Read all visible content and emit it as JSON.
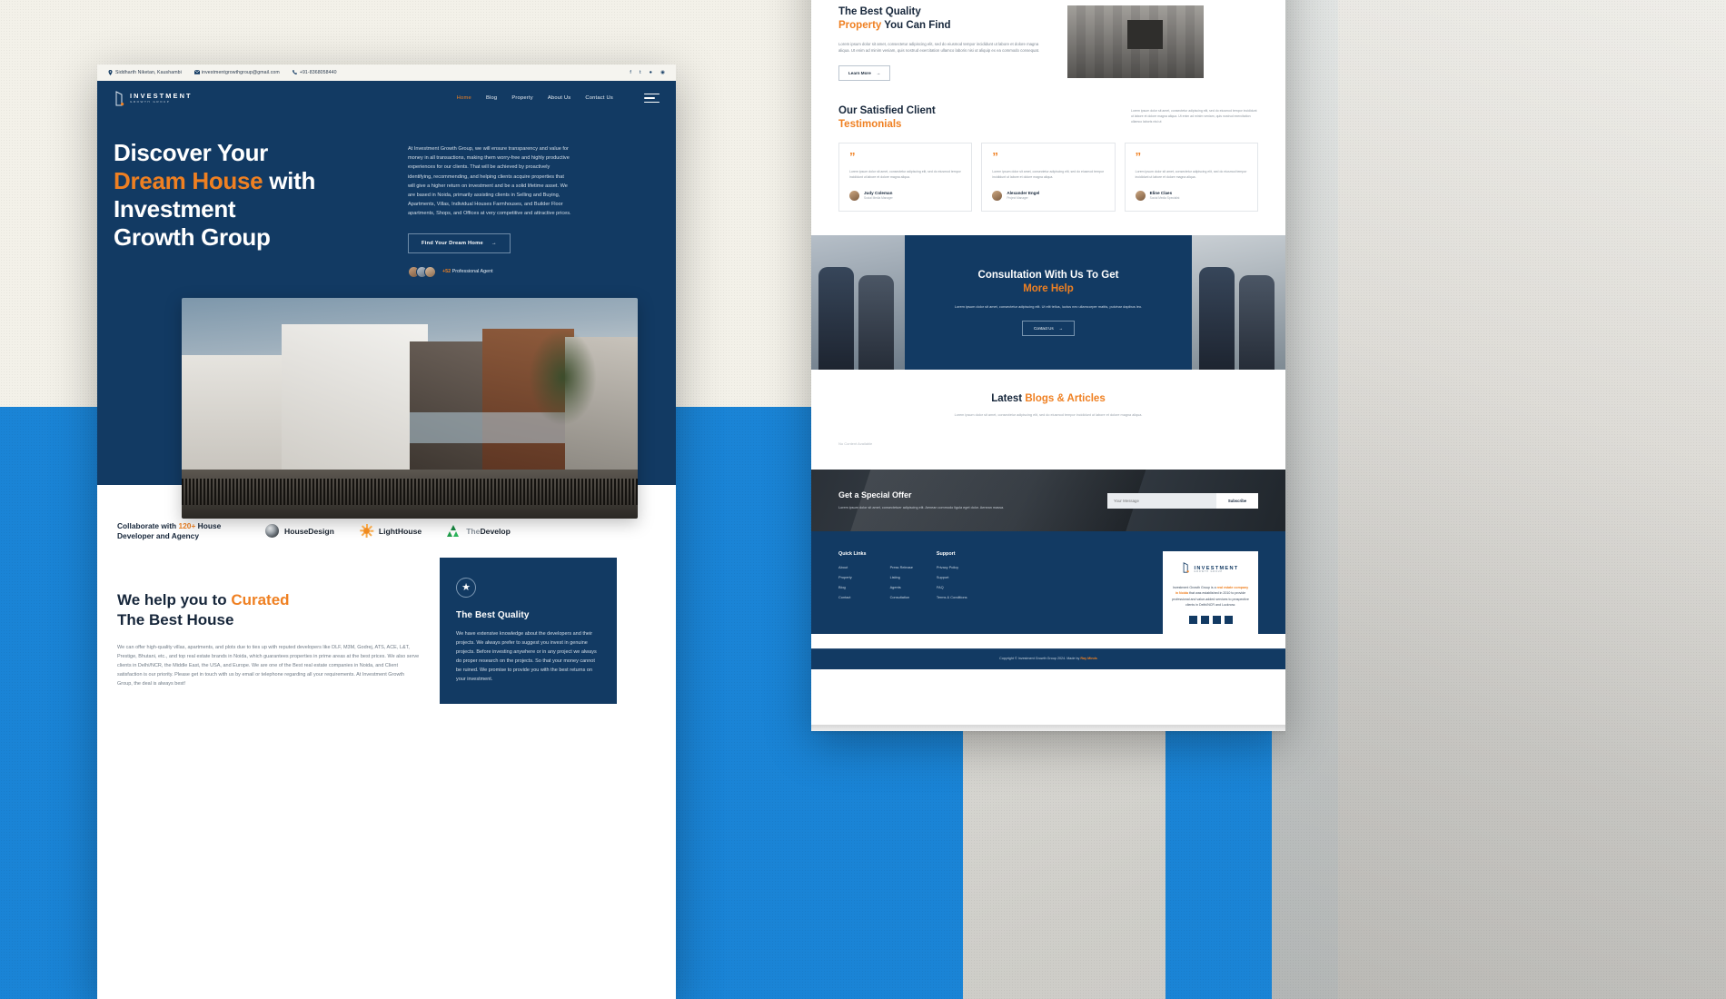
{
  "topbar": {
    "address": "Siddharth Niketan, Kaushambi",
    "email": "investmentgrowthgroup@gmail.com",
    "phone": "+91-8368058440",
    "socials": [
      "facebook",
      "twitter",
      "github",
      "dribbble"
    ]
  },
  "brand": {
    "name": "INVESTMENT",
    "tagline": "GROWTH GROUP"
  },
  "nav": {
    "items": [
      "Home",
      "Blog",
      "Property",
      "About Us",
      "Contact Us"
    ],
    "active": "Home"
  },
  "hero": {
    "title_line1": "Discover Your",
    "title_accent": "Dream House",
    "title_after": " with",
    "title_line3": "Investment",
    "title_line4": "Growth Group",
    "paragraph": "At Investment Growth Group, we will ensure transparency and value for money in all transactions, making them worry-free and highly productive experiences for our clients. That will be achieved by proactively identifying, recommending, and helping clients acquire properties that will give a higher return on investment and be a solid lifetime asset. We are based in Noida, primarily assisting clients in Selling and Buying, Apartments, Villas, Individual Houses Farmhouses, and Builder Floor apartments, Shops, and Offices at very competitive and attractive prices.",
    "cta": "Find Your Dream Home",
    "agent_count": "+52",
    "agent_label": "Professional Agent"
  },
  "partners": {
    "text_pre": "Collaborate with ",
    "text_accent": "120+",
    "text_post": " House Developer and Agency",
    "logos": [
      {
        "name": "HouseDesign",
        "icon": "sphere-icon"
      },
      {
        "name": "LightHouse",
        "icon": "sun-icon"
      },
      {
        "name": "TheDevelop",
        "icon": "triangles-icon",
        "grey_part": "The"
      }
    ]
  },
  "curated": {
    "title_pre": "We help you to ",
    "title_accent": "Curated",
    "title_line2": "The Best House",
    "paragraph": "We can offer high-quality villas, apartments, and plots due to ties up with reputed developers like DLF, M3M, Godrej, ATS, ACE, L&T, Prestige, Bhutani, etc., and top real estate brands in Noida, which guarantees properties in prime areas at the best prices. We also serve clients in Delhi/NCR, the Middle East, the USA, and Europe. We are one of the Best real estate companies in Noida, and Client satisfaction is our priority. Please get in touch with us by email or telephone regarding all your requirements. At Investment Growth Group, the deal is always best!",
    "card": {
      "icon": "award-icon",
      "title": "The Best Quality",
      "paragraph": "We have extensive knowledge about the developers and their projects. We always prefer to suggest you invest in genuine projects. Before investing anywhere or in any project we always do proper research on the projects. So that your money cannot be ruined. We promise to provide you with the best returns on your investment."
    }
  },
  "quality": {
    "title_line1": "The Best Quality",
    "title_accent": "Property",
    "title_after": " You Can Find",
    "paragraph": "Lorem ipsum dolor sit amet, consectetur adipiscing elit, sed do eiusmod tempor incididunt ut labore et dolore magna aliqua. Ut enim ad minim veniam, quis nostrud exercitation ullamco laboris nisi ut aliquip ex ea commodo consequat.",
    "cta": "Learn More"
  },
  "testimonials": {
    "title_line1": "Our Satisfied Client",
    "title_accent": "Testimonials",
    "side_paragraph": "Lorem ipsum dolor sit amet, consectetur adipiscing elit, sed do eiusmod tempor incididunt ut labore et dolore magna aliqua. Ut enim ad minim veniam, quis nostrud exercitation ullamco laboris nisi ut",
    "items": [
      {
        "quote": "Lorem ipsum dolor sit amet, consectetur adipiscing elit, sed do eiusmod tempor incididunt ut labore et dolore magna aliqua.",
        "name": "Judy Coleman",
        "role": "Social Media Manager"
      },
      {
        "quote": "Lorem ipsum dolor sit amet, consectetur adipiscing elit, sed do eiusmod tempor incididunt ut labore et dolore magna aliqua.",
        "name": "Alexander Engel",
        "role": "Project Manager"
      },
      {
        "quote": "Lorem ipsum dolor sit amet, consectetur adipiscing elit, sed do eiusmod tempor incididunt ut labore et dolore magna aliqua.",
        "name": "Eline Claes",
        "role": "Social Media Specialist"
      }
    ]
  },
  "consultation": {
    "title_line1": "Consultation With Us To Get",
    "title_accent": "More Help",
    "paragraph": "Lorem ipsum dolor sit amet, consectetur adipiscing elit. Ut elit tellus, luctus nec ullamcorper mattis, pulvinar dapibus leo.",
    "cta": "Contact Us"
  },
  "blogs": {
    "title_pre": "Latest ",
    "title_accent": "Blogs & Articles",
    "paragraph": "Lorem ipsum dolor sit amet, consectetur adipiscing elit, sed do eiusmod tempor incididunt ut labore et dolore magna aliqua.",
    "empty": "No Content Available"
  },
  "offer": {
    "title": "Get a Special Offer",
    "paragraph": "Lorem ipsum dolor sit amet, consectetuer adipiscing elit. Aenean commodo ligula eget dolor. Aenean massa.",
    "input_placeholder": "Your Message",
    "button": "Subscribe"
  },
  "footer": {
    "col1": {
      "heading": "Quick Links",
      "links": [
        "About",
        "Property",
        "Blog",
        "Contact"
      ]
    },
    "col2": {
      "heading": "",
      "links": [
        "Press Release",
        "Listing",
        "Agents",
        "Consultation"
      ]
    },
    "col3": {
      "heading": "Support",
      "links": [
        "Privacy Policy",
        "Support",
        "FAQ",
        "Terms & Conditions"
      ]
    },
    "card": {
      "brand": "INVESTMENT",
      "tagline": "GROWTH GROUP",
      "text_pre": "Investment Growth Group is a ",
      "text_accent": "real estate company in Noida",
      "text_post": " that was established in 2010 to provide professional and value-added services to prospective clients in Delhi/NCR and Lucknow.",
      "socials": [
        "facebook",
        "twitter",
        "instagram",
        "linkedin"
      ]
    },
    "copyright_pre": "Copyright © Investment Growth Group 2024. Made by ",
    "copyright_accent": "Ray Minds"
  },
  "colors": {
    "navy": "#123a63",
    "orange": "#ef8022",
    "blue_bg": "#1a84d6",
    "cream": "#f3f1e9"
  }
}
